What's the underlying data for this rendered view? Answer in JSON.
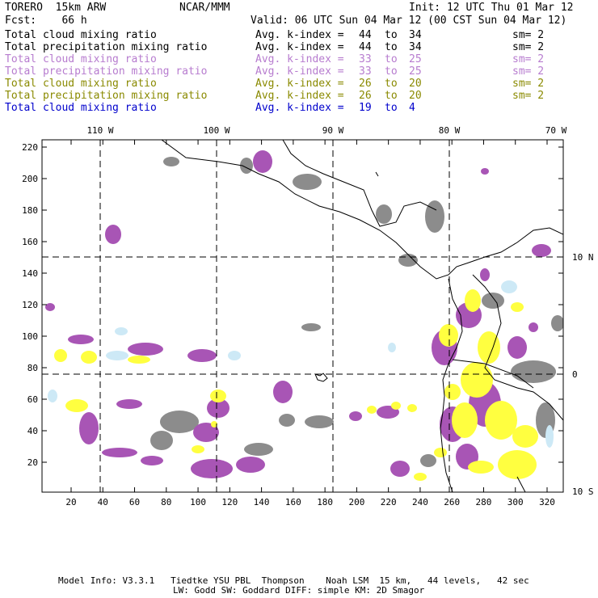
{
  "header": {
    "model": "TORERO  15km ARW",
    "org": "NCAR/MMM",
    "init": "Init: 12 UTC Thu 01 Mar 12",
    "fcst": "Fcst:    66 h",
    "valid": "Valid: 06 UTC Sun 04 Mar 12 (00 CST Sun 04 Mar 12)"
  },
  "legend": [
    {
      "field": "Total cloud mixing ratio",
      "stat": "Avg. k-index =",
      "hi": "44",
      "to": "to",
      "lo": "34",
      "sm": "sm= 2",
      "color": "#000000"
    },
    {
      "field": "Total precipitation mixing ratio",
      "stat": "Avg. k-index =",
      "hi": "44",
      "to": "to",
      "lo": "34",
      "sm": "sm= 2",
      "color": "#000000"
    },
    {
      "field": "Total cloud mixing ratio",
      "stat": "Avg. k-index =",
      "hi": "33",
      "to": "to",
      "lo": "25",
      "sm": "sm= 2",
      "color": "#b77ccf"
    },
    {
      "field": "Total precipitation mixing ratio",
      "stat": "Avg. k-index =",
      "hi": "33",
      "to": "to",
      "lo": "25",
      "sm": "sm= 2",
      "color": "#b77ccf"
    },
    {
      "field": "Total cloud mixing ratio",
      "stat": "Avg. k-index =",
      "hi": "26",
      "to": "to",
      "lo": "20",
      "sm": "sm= 2",
      "color": "#8a8a00"
    },
    {
      "field": "Total precipitation mixing ratio",
      "stat": "Avg. k-index =",
      "hi": "26",
      "to": "to",
      "lo": "20",
      "sm": "sm= 2",
      "color": "#8a8a00"
    },
    {
      "field": "Total cloud mixing ratio",
      "stat": "Avg. k-index =",
      "hi": "19",
      "to": "to",
      "lo": "4",
      "sm": "",
      "color": "#0000cc"
    }
  ],
  "map": {
    "lon_labels": [
      "110 W",
      "100 W",
      "90 W",
      "80 W",
      "70 W"
    ],
    "lat_labels": [
      "10 N",
      "0",
      "10 S"
    ],
    "y_ticks": [
      "220",
      "200",
      "180",
      "160",
      "140",
      "120",
      "100",
      "80",
      "60",
      "40",
      "20"
    ],
    "x_ticks": [
      "20",
      "40",
      "60",
      "80",
      "100",
      "120",
      "140",
      "160",
      "180",
      "200",
      "220",
      "240",
      "260",
      "280",
      "300",
      "320"
    ],
    "colors": {
      "gray": "#8c8c8c",
      "purple": "#a855b5",
      "yellow": "#ffff40",
      "lightblue": "#cde9f6",
      "land": "#ffffff",
      "coast": "#000000"
    }
  },
  "footer": {
    "line1": "Model Info: V3.3.1   Tiedtke YSU PBL  Thompson    Noah LSM  15 km,   44 levels,   42 sec",
    "line2": "LW: Godd SW: Goddard DIFF: simple KM: 2D Smagor"
  }
}
